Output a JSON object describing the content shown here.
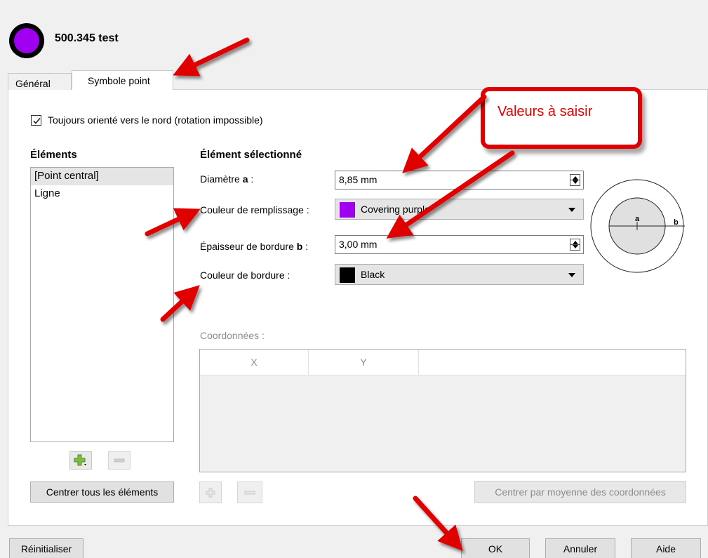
{
  "header": {
    "title": "500.345 test"
  },
  "tabs": [
    {
      "label": "Général",
      "active": false
    },
    {
      "label": "Symbole point",
      "active": true
    }
  ],
  "north_checkbox": {
    "label": "Toujours orienté vers le nord (rotation impossible)",
    "checked": true
  },
  "elements": {
    "title": "Éléments",
    "items": [
      {
        "label": "[Point central]",
        "selected": true
      },
      {
        "label": "Ligne",
        "selected": false
      }
    ],
    "center_all_label": "Centrer tous les éléments"
  },
  "selected_element": {
    "title": "Élément sélectionné",
    "diameter": {
      "label_prefix": "Diamètre ",
      "label_bold": "a",
      "label_suffix": " :",
      "value": "8,85 mm"
    },
    "fill_color": {
      "label": "Couleur de remplissage :",
      "value": "Covering purple",
      "swatch": "#a000f0"
    },
    "border_width": {
      "label_prefix": "Épaisseur de bordure ",
      "label_bold": "b",
      "label_suffix": " :",
      "value": "3,00 mm"
    },
    "border_color": {
      "label": "Couleur de bordure :",
      "value": "Black",
      "swatch": "#000000"
    }
  },
  "preview": {
    "label_a": "a",
    "label_b": "b"
  },
  "coordinates": {
    "label": "Coordonnées :",
    "columns": [
      "X",
      "Y"
    ],
    "center_avg_label": "Centrer par moyenne des coordonnées"
  },
  "footer": {
    "reset_label": "Réinitialiser",
    "ok_label": "OK",
    "cancel_label": "Annuler",
    "help_label": "Aide"
  },
  "annotation": {
    "callout_text": "Valeurs à saisir",
    "color": "#e00000"
  },
  "colors": {
    "purple": "#a000f0",
    "annotation_red": "#e00000"
  }
}
